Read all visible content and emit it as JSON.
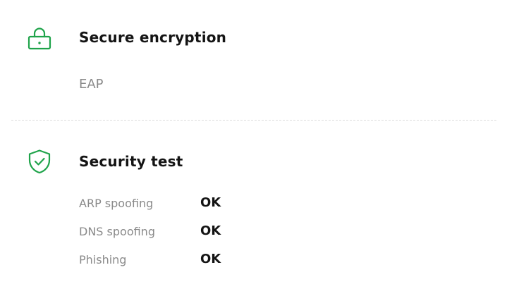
{
  "colors": {
    "accent": "#1fa34a",
    "title": "#141414",
    "muted": "#8a8a8a",
    "divider": "#dcdcdc"
  },
  "encryption": {
    "icon": "lock-icon",
    "title": "Secure encryption",
    "value": "EAP"
  },
  "security_test": {
    "icon": "shield-check-icon",
    "title": "Security test",
    "items": [
      {
        "label": "ARP spoofing",
        "result": "OK"
      },
      {
        "label": "DNS spoofing",
        "result": "OK"
      },
      {
        "label": "Phishing",
        "result": "OK"
      }
    ]
  }
}
